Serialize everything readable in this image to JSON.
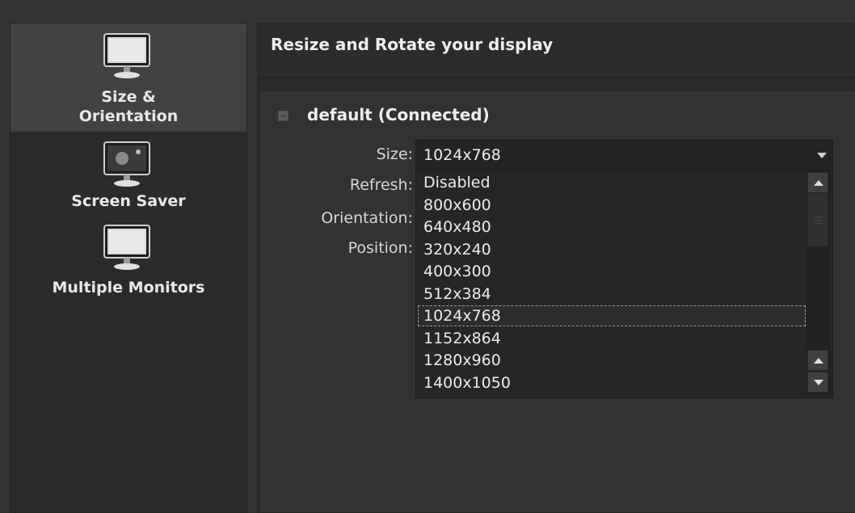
{
  "sidebar": {
    "items": [
      {
        "label": "Size &\nOrientation",
        "icon": "monitor-icon",
        "selected": true
      },
      {
        "label": "Screen Saver",
        "icon": "screen-saver-icon",
        "selected": false
      },
      {
        "label": "Multiple Monitors",
        "icon": "monitor-icon",
        "selected": false
      }
    ]
  },
  "header": {
    "title": "Resize and Rotate your display"
  },
  "device": {
    "title": "default (Connected)",
    "labels": {
      "size": "Size:",
      "refresh": "Refresh:",
      "orientation": "Orientation:",
      "position": "Position:"
    },
    "size_value": "1024x768",
    "size_options": [
      "Disabled",
      "800x600",
      "640x480",
      "320x240",
      "400x300",
      "512x384",
      "1024x768",
      "1152x864",
      "1280x960",
      "1400x1050"
    ],
    "focused_option": "1024x768"
  },
  "colors": {
    "background": "#343434",
    "selected_item": "#424242",
    "text": "#e4e4e4"
  }
}
